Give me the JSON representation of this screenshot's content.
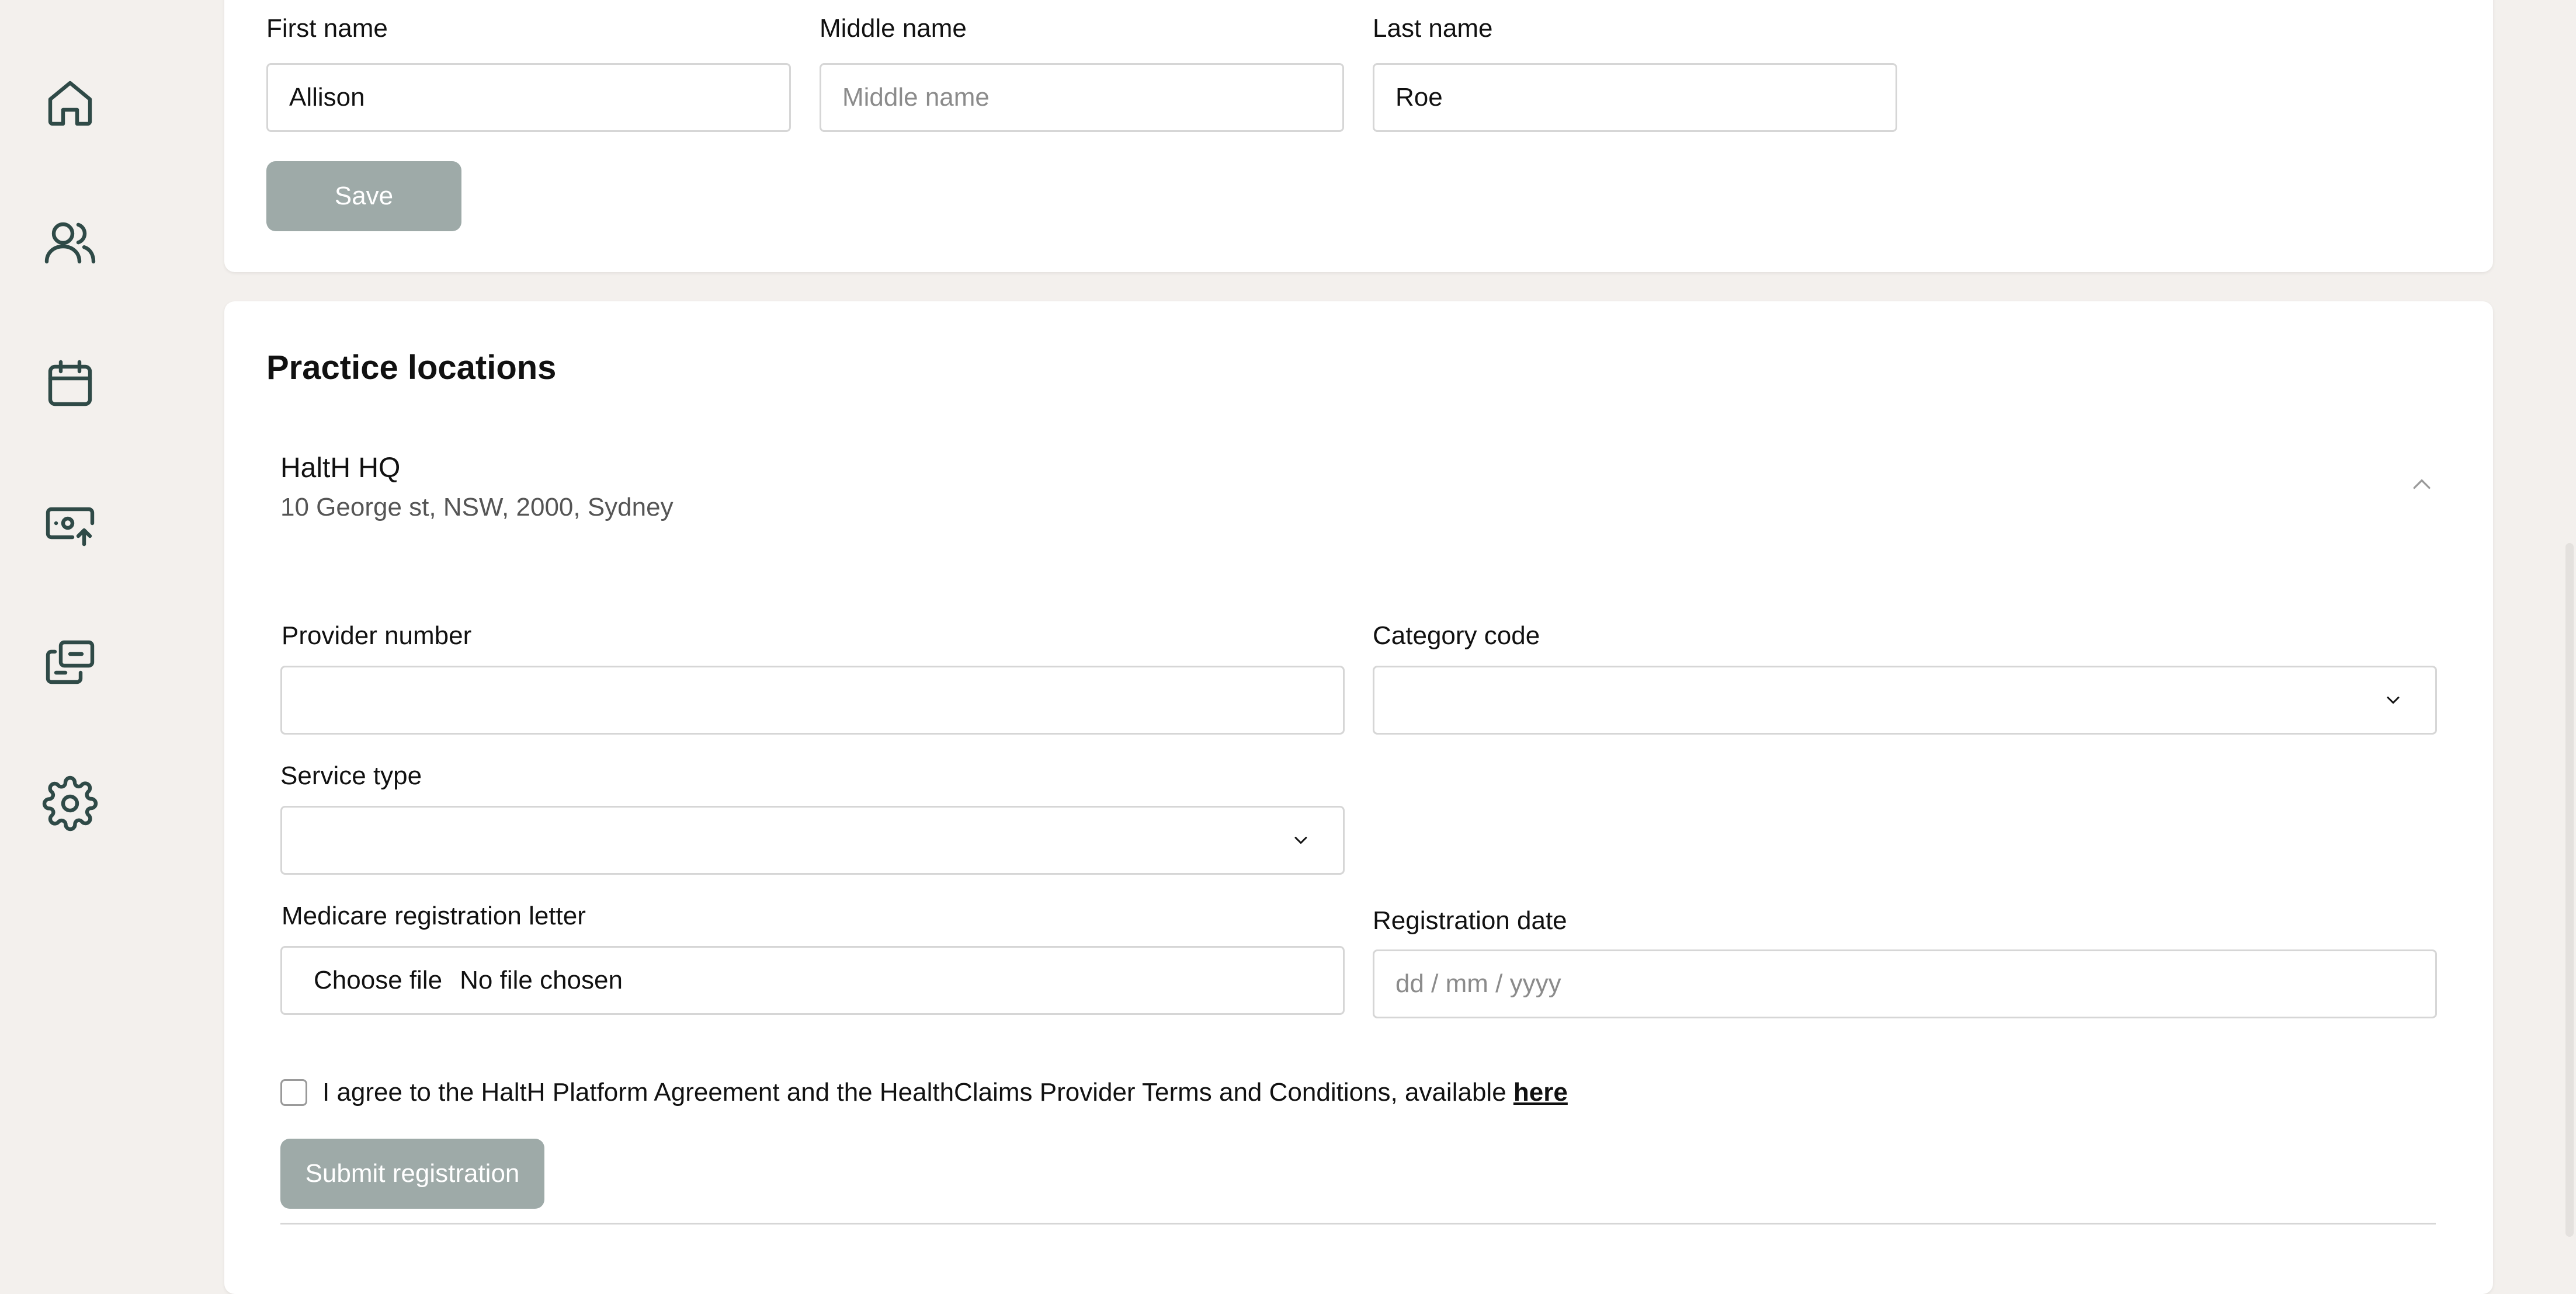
{
  "sidebar": {
    "items": [
      {
        "icon": "home-icon"
      },
      {
        "icon": "users-icon"
      },
      {
        "icon": "calendar-icon"
      },
      {
        "icon": "money-upload-icon"
      },
      {
        "icon": "cards-icon"
      },
      {
        "icon": "gear-icon"
      }
    ]
  },
  "profile": {
    "first_name_label": "First name",
    "first_name_value": "Allison",
    "middle_name_label": "Middle name",
    "middle_name_placeholder": "Middle name",
    "last_name_label": "Last name",
    "last_name_value": "Roe",
    "save_label": "Save"
  },
  "practice": {
    "title": "Practice locations",
    "location_name": "HaltH HQ",
    "location_address": "10 George st, NSW, 2000, Sydney",
    "provider_number_label": "Provider number",
    "provider_number_value": "",
    "category_code_label": "Category code",
    "category_code_value": "",
    "service_type_label": "Service type",
    "service_type_value": "",
    "medicare_letter_label": "Medicare registration letter",
    "choose_file_label": "Choose file",
    "no_file_label": "No file chosen",
    "registration_date_label": "Registration date",
    "registration_date_placeholder": "dd / mm / yyyy",
    "agree_text": "I agree to the HaltH Platform Agreement and the HealthClaims Provider Terms and Conditions, available ",
    "agree_link": "here",
    "agree_checked": false,
    "submit_label": "Submit registration"
  },
  "colors": {
    "background": "#f3f0ed",
    "icon": "#2f4a47",
    "button_disabled": "#9eaaa8"
  }
}
